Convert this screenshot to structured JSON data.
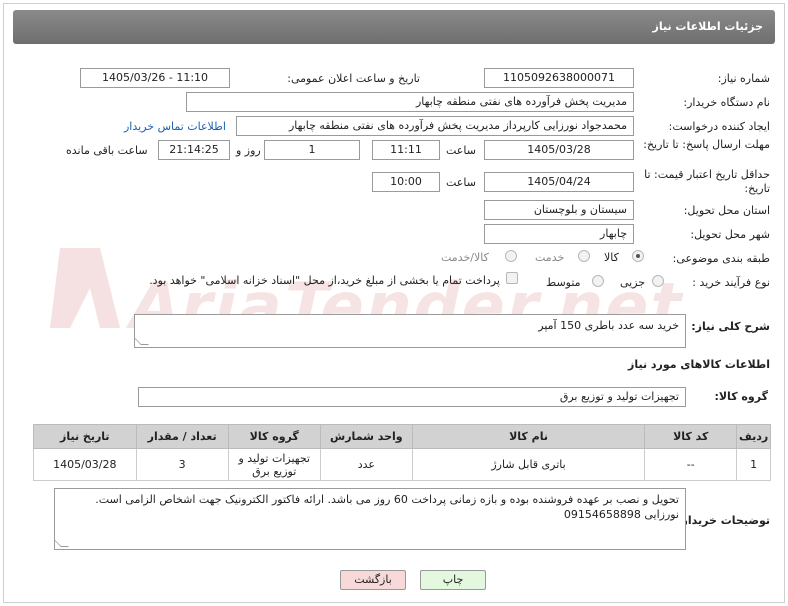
{
  "header": {
    "title": "جزئیات اطلاعات نیاز"
  },
  "form": {
    "need_number_label": "شماره نیاز:",
    "need_number": "1105092638000071",
    "announce_label": "تاریخ و ساعت اعلان عمومی:",
    "announce_value": "1405/03/26 - 11:10",
    "buyer_org_label": "نام دستگاه خریدار:",
    "buyer_org": "مدیریت پخش فرآورده های نفتی منطقه چابهار",
    "creator_label": "ایجاد کننده درخواست:",
    "creator": "محمدجواد نورزایی کارپرداز مدیریت پخش فرآورده های نفتی منطقه چابهار",
    "contact_link": "اطلاعات تماس خریدار",
    "reply_deadline_label": "مهلت ارسال پاسخ: تا تاریخ:",
    "reply_date": "1405/03/28",
    "time_label": "ساعت",
    "reply_time": "11:11",
    "days_value": "1",
    "days_label": "روز و",
    "remaining_time": "21:14:25",
    "remaining_label": "ساعت باقی مانده",
    "price_validity_label": "حداقل تاریخ اعتبار قیمت: تا تاریخ:",
    "price_date": "1405/04/24",
    "price_time": "10:00",
    "province_label": "استان محل تحویل:",
    "province": "سیستان و بلوچستان",
    "city_label": "شهر محل تحویل:",
    "city": "چابهار",
    "category_label": "طبقه بندی موضوعی:",
    "category_options": [
      "کالا",
      "خدمت",
      "کالا/خدمت"
    ],
    "process_label": "نوع فرآیند خرید :",
    "process_options": [
      "جزیی",
      "متوسط"
    ],
    "payment_note": "پرداخت تمام یا بخشی از مبلغ خرید،از محل \"اسناد خزانه اسلامی\" خواهد بود.",
    "description_label": "شرح کلی نیاز:",
    "description": "خرید سه عدد باطری 150 آمپر",
    "goods_info_label": "اطلاعات کالاهای مورد نیاز",
    "goods_group_label": "گروه کالا:",
    "goods_group": "تجهیزات تولید و توزیع برق",
    "buyer_notes_label": "توضیحات خریدار:",
    "buyer_notes": "تحویل و نصب بر عهده فروشنده بوده و بازه زمانی پرداخت 60 روز می باشد. ارائه فاکتور الکترونیک جهت اشخاص الزامی است. نورزایی 09154658898"
  },
  "table": {
    "headers": [
      "ردیف",
      "کد کالا",
      "نام کالا",
      "واحد شمارش",
      "گروه کالا",
      "تعداد / مقدار",
      "تاریخ نیاز"
    ],
    "rows": [
      [
        "1",
        "--",
        "باتری قابل شارژ",
        "عدد",
        "تجهیزات تولید و توزیع برق",
        "3",
        "1405/03/28"
      ]
    ]
  },
  "buttons": {
    "print": "چاپ",
    "back": "بازگشت"
  },
  "watermark": {
    "text": "AriaTender.net"
  },
  "colors": {
    "header_bg": "#7a7a7a",
    "link": "#1a5fb4",
    "back_button": "#f7d9d9",
    "print_button": "#e4f7df"
  }
}
